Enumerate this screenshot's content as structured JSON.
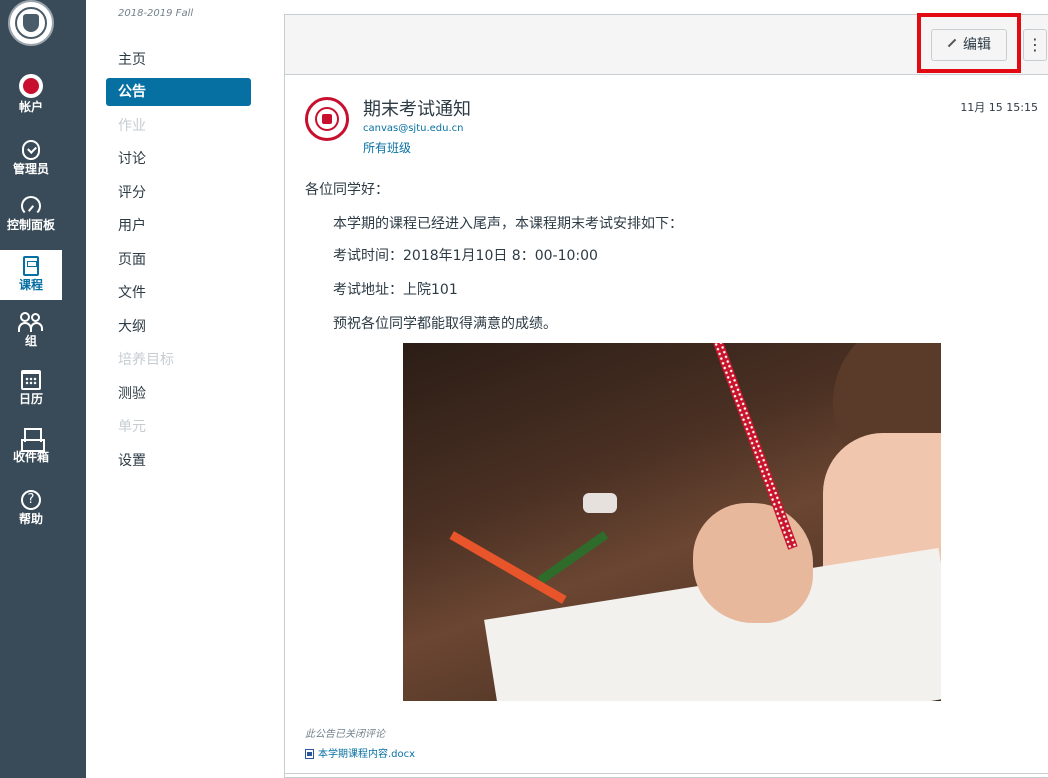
{
  "global_nav": {
    "items": [
      {
        "label": "帐户",
        "icon": "account-avatar-icon"
      },
      {
        "label": "管理员",
        "icon": "admin-shield-icon"
      },
      {
        "label": "控制面板",
        "icon": "dashboard-gauge-icon"
      },
      {
        "label": "课程",
        "icon": "courses-book-icon"
      },
      {
        "label": "组",
        "icon": "groups-people-icon"
      },
      {
        "label": "日历",
        "icon": "calendar-icon"
      },
      {
        "label": "收件箱",
        "icon": "inbox-icon"
      },
      {
        "label": "帮助",
        "icon": "help-icon"
      }
    ],
    "help_glyph": "?",
    "active_index": 3,
    "colors": {
      "background": "#394b58",
      "active": "#0770a3"
    }
  },
  "course_nav": {
    "term": "2018-2019 Fall",
    "items": [
      {
        "label": "主页",
        "state": "normal"
      },
      {
        "label": "公告",
        "state": "active"
      },
      {
        "label": "作业",
        "state": "disabled"
      },
      {
        "label": "讨论",
        "state": "normal"
      },
      {
        "label": "评分",
        "state": "normal"
      },
      {
        "label": "用户",
        "state": "normal"
      },
      {
        "label": "页面",
        "state": "normal"
      },
      {
        "label": "文件",
        "state": "normal"
      },
      {
        "label": "大纲",
        "state": "normal"
      },
      {
        "label": "培养目标",
        "state": "disabled"
      },
      {
        "label": "测验",
        "state": "normal"
      },
      {
        "label": "单元",
        "state": "disabled"
      },
      {
        "label": "设置",
        "state": "normal"
      }
    ]
  },
  "toolbar": {
    "edit_label": "编辑",
    "more_glyph": "⋮",
    "highlight_color": "#e30b13"
  },
  "announcement": {
    "title": "期末考试通知",
    "author": "canvas@sjtu.edu.cn",
    "section": "所有班级",
    "date": "11月 15 15:15",
    "greeting": "各位同学好：",
    "paragraphs": [
      "本学期的课程已经进入尾声，本课程期末考试安排如下：",
      "考试时间：2018年1月10日 8：00-10:00",
      "考试地址：上院101",
      "预祝各位同学都能取得满意的成绩。"
    ],
    "comments_closed": "此公告已关闭评论",
    "attachment": "本学期课程内容.docx"
  }
}
